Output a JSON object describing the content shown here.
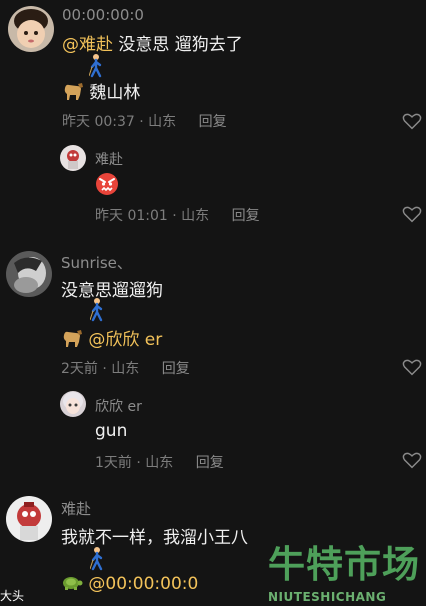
{
  "comments": [
    {
      "username": "00:00:00:0",
      "line1": {
        "mention": "@难赴",
        "text": "没意思 遛狗去了"
      },
      "line2": {
        "text": "魏山林"
      },
      "meta": "昨天 00:37 · 山东",
      "reply_label": "回复"
    },
    {
      "username": "难赴",
      "emoji": "angry-face",
      "meta": "昨天 01:01 · 山东",
      "reply_label": "回复"
    },
    {
      "username": "Sunrise、",
      "line1": {
        "text": "没意思遛遛狗"
      },
      "line2": {
        "mention": "@欣欣 er"
      },
      "meta": "2天前 · 山东",
      "reply_label": "回复"
    },
    {
      "username": "欣欣 er",
      "line1": {
        "text": "gun"
      },
      "meta": "1天前 · 山东",
      "reply_label": "回复"
    },
    {
      "username": "难赴",
      "line1": {
        "text": "我就不一样，我溜小王八"
      },
      "line2": {
        "mention": "@00:00:00:0"
      }
    }
  ],
  "icons": {
    "like": "heart-outline-icon",
    "walker": "person-walking-emoji",
    "dog": "dog-emoji",
    "turtle": "turtle-emoji"
  },
  "watermark": {
    "title": "牛特市场",
    "subtitle": "NIUTESHICHANG"
  },
  "edge_text": "大头",
  "colors": {
    "background": "#141414",
    "mention": "#f2c25a",
    "watermark": "#4ea05a"
  }
}
